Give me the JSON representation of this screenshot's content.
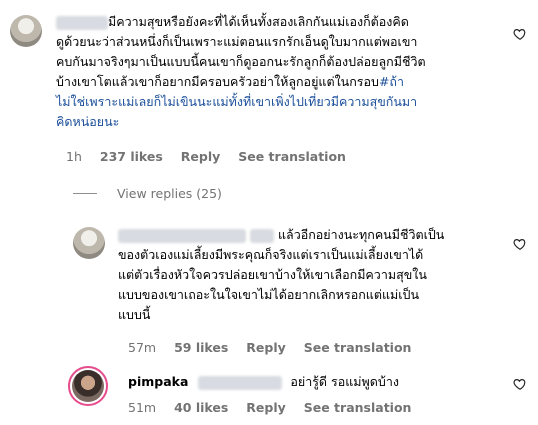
{
  "comment1": {
    "username": "",
    "lines": [
      "มีความสุขหรือยังคะที่ได้เห็นทั้งสองเลิกกันแม่เองก็ต้องคิด",
      "ดูด้วยนะว่าส่วนหนึ่งก็เป็นเพราะแม่ตอนแรกรักเอ็นดูใบมากแต่พอเขา",
      "คบกันมาจริงๆมาเป็นแบบนี้คนเขาก็ดูออกนะรักลูกก็ต้องปล่อยลูกมีชีวิต",
      "บ้างเขาโตแล้วเขาก็อยากมีครอบครัวอย่าให้ลูกอยู่แต่ในกรอบ"
    ],
    "hashtag_lines": [
      "#ถ้า",
      "ไม่ใช่เพราะแม่เลยก็ไม่เขินนะแม่ทั้งที่เขาเพิ่งไปเที่ยวมีความสุขกันมา",
      "คิดหน่อยนะ"
    ],
    "time": "1h",
    "likes": "237 likes",
    "reply_label": "Reply",
    "translation_label": "See translation"
  },
  "view_replies_label": "View replies (25)",
  "reply1": {
    "lines": [
      "แล้วอีกอย่างนะทุกคนมีชีวิตเป็น",
      "ของตัวเองแม่เลี้ยงมีพระคุณก็จริงแต่เราเป็นแม่เลี้ยงเขาได้",
      "แต่ตัวเรื่องหัวใจควรปล่อยเขาบ้างให้เขาเลือกมีความสุขใน",
      "แบบของเขาเถอะในใจเขาไม่ได้อยากเลิกหรอกแต่แม่เป็น",
      "แบบนี้"
    ],
    "time": "57m",
    "likes": "59 likes",
    "reply_label": "Reply",
    "translation_label": "See translation"
  },
  "reply2": {
    "username": "pimpaka",
    "text": "อย่ารู้ดี รอแม่พูดบ้าง",
    "time": "51m",
    "likes": "40 likes",
    "reply_label": "Reply",
    "translation_label": "See translation"
  },
  "colors": {
    "hashtag": "#1b4f9a",
    "meta": "#737373",
    "story_ring": "#e64b8c"
  },
  "icons": [
    "heart-outline-icon"
  ]
}
